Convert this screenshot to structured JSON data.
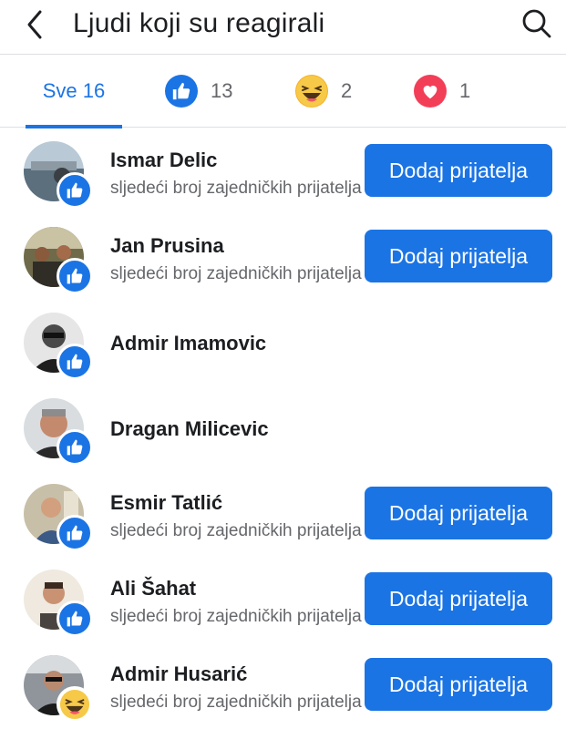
{
  "header": {
    "title": "Ljudi koji su reagirali",
    "back_icon": "chevron-left-icon",
    "search_icon": "search-icon"
  },
  "tabs": {
    "all": {
      "label": "Sve 16"
    },
    "like": {
      "icon": "like-icon",
      "count": "13"
    },
    "haha": {
      "icon": "haha-icon",
      "count": "2"
    },
    "love": {
      "icon": "love-icon",
      "count": "1"
    }
  },
  "colors": {
    "accent": "#1b74e4",
    "love": "#f33e58",
    "haha": "#f7b125"
  },
  "people": [
    {
      "name": "Ismar Delic",
      "subtitle": "sljedeći broj zajedničkih prijatelja",
      "button": "Dodaj prijatelja",
      "reaction": "like"
    },
    {
      "name": "Jan Prusina",
      "subtitle": "sljedeći broj zajedničkih prijatelja",
      "button": "Dodaj prijatelja",
      "reaction": "like"
    },
    {
      "name": "Admir Imamovic",
      "reaction": "like"
    },
    {
      "name": "Dragan Milicevic",
      "reaction": "like"
    },
    {
      "name": "Esmir Tatlić",
      "subtitle": "sljedeći broj zajedničkih prijatelja",
      "button": "Dodaj prijatelja",
      "reaction": "like"
    },
    {
      "name": "Ali Šahat",
      "subtitle": "sljedeći broj zajedničkih prijatelja",
      "button": "Dodaj prijatelja",
      "reaction": "like"
    },
    {
      "name": "Admir Husarić",
      "subtitle": "sljedeći broj zajedničkih prijatelja",
      "button": "Dodaj prijatelja",
      "reaction": "haha"
    }
  ]
}
